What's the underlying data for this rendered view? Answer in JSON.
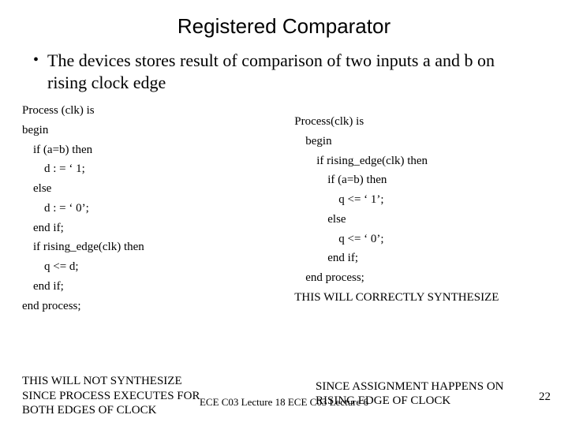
{
  "title": "Registered Comparator",
  "bullet": "The devices stores result of comparison of two inputs a and b on rising clock edge",
  "left": {
    "l0": "Process (clk) is",
    "l1": "begin",
    "l2": "if (a=b) then",
    "l3": "d : = ‘ 1;",
    "l4": "else",
    "l5": "d : = ‘ 0’;",
    "l6": "end if;",
    "l7": "if rising_edge(clk) then",
    "l8": "q <= d;",
    "l9": "end if;",
    "l10": "end process;"
  },
  "right": {
    "r0": "Process(clk) is",
    "r1": "begin",
    "r2": "if rising_edge(clk) then",
    "r3": "if (a=b) then",
    "r4": "q <= ‘ 1’;",
    "r5": "else",
    "r6": "q <= ‘ 0’;",
    "r7": "end if;",
    "r8": "end process;",
    "r9": "THIS WILL CORRECTLY SYNTHESIZE"
  },
  "footer_left": {
    "a": "THIS WILL NOT SYNTHESIZE",
    "b": "SINCE PROCESS EXECUTES FOR",
    "c": "BOTH EDGES OF CLOCK"
  },
  "footer_right": {
    "a": "SINCE ASSIGNMENT HAPPENS ON",
    "b": "RISING EDGE OF CLOCK"
  },
  "footer_center": "ECE C03 Lecture 18 ECE C03 Lecture 6",
  "page_number": "22"
}
